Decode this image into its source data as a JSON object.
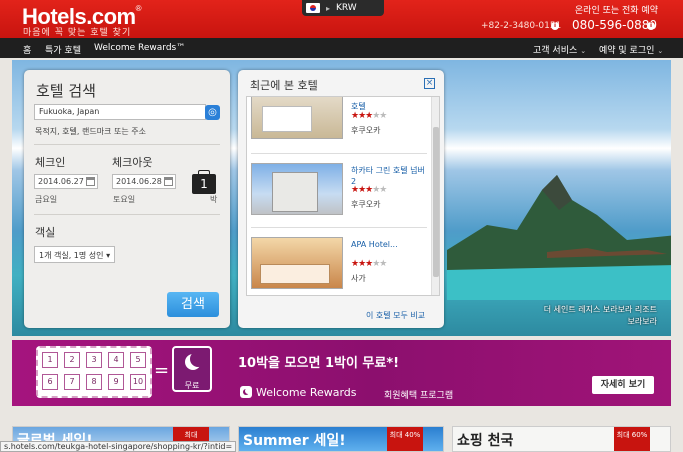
{
  "header": {
    "logo": "Hotels.com",
    "logo_mark": "®",
    "tagline": "마음에 꼭 맞는 호텔 찾기",
    "currency": "KRW",
    "contact_label": "온라인 또는 전화 예약",
    "phone_primary": "+82-2-3480-0151",
    "phone_secondary": "080-596-0880"
  },
  "nav": {
    "home": "홈",
    "deals": "특가 호텔",
    "rewards": "Welcome Rewards™",
    "customer_service": "고객 서비스",
    "bookings_login": "예약 및 로그인"
  },
  "search": {
    "title": "호텔 검색",
    "destination_value": "Fukuoka, Japan",
    "destination_hint": "목적지, 호텔, 랜드마크 또는 주소",
    "checkin_label": "체크인",
    "checkin_value": "2014.06.27",
    "checkin_weekday": "금요일",
    "checkout_label": "체크아웃",
    "checkout_value": "2014.06.28",
    "checkout_weekday": "토요일",
    "nights": "1",
    "nights_label": "박",
    "rooms_label": "객실",
    "rooms_value": "1개 객실, 1명 성인",
    "button": "검색"
  },
  "recent": {
    "title": "최근에 본 호텔",
    "view_all": "이 호텔 모두 비교",
    "items": [
      {
        "name": "호텔",
        "city": "후쿠오카",
        "stars": 3
      },
      {
        "name": "하카타 그린 호텔 넘버 2",
        "city": "후쿠오카",
        "stars": 3
      },
      {
        "name": "APA Hotel...",
        "city": "사가",
        "stars": 3
      }
    ]
  },
  "hero": {
    "caption_line1": "더 세인트 레지스 보라보라 리조트",
    "caption_line2": "보라보라"
  },
  "rewards_banner": {
    "stamps": [
      "1",
      "2",
      "3",
      "4",
      "5",
      "6",
      "7",
      "8",
      "9",
      "10"
    ],
    "free_label": "무료",
    "headline": "10박을 모으면 1박이 무료*!",
    "program_name": "Welcome Rewards",
    "program_sub": "회원혜택 프로그램",
    "more_button": "자세히 보기"
  },
  "promos": [
    {
      "text": "글로벌 세일!",
      "tag": "최대"
    },
    {
      "text": "Summer 세일!",
      "tag": "최대 40%"
    },
    {
      "text": "쇼핑 천국",
      "tag": "최대 60%"
    }
  ],
  "status_url": "s.hotels.com/teukga-hotel-singapore/shopping-kr/?intid=",
  "colors": {
    "brand_red": "#d21a14",
    "nav_dark": "#1f1f1f",
    "search_blue": "#2c8fdc",
    "rewards_purple": "#8c0f6e"
  }
}
